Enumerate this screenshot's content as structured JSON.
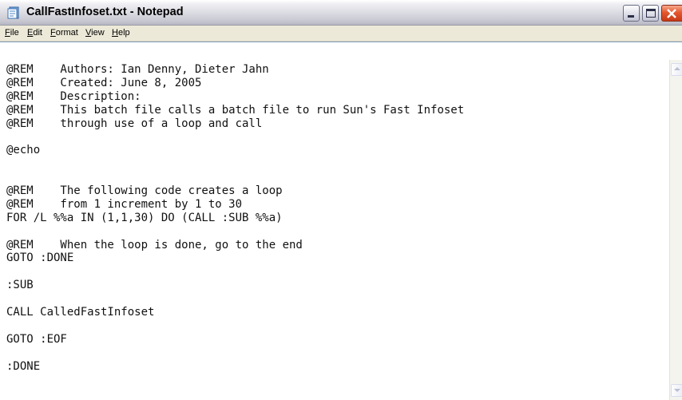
{
  "window": {
    "title": "CallFastInfoset.txt - Notepad",
    "app_icon": "notepad-icon"
  },
  "menu": [
    {
      "label": "File"
    },
    {
      "label": "Edit"
    },
    {
      "label": "Format"
    },
    {
      "label": "View"
    },
    {
      "label": "Help"
    }
  ],
  "editor": {
    "lines": [
      "@REM    Authors: Ian Denny, Dieter Jahn",
      "@REM    Created: June 8, 2005",
      "@REM    Description:",
      "@REM    This batch file calls a batch file to run Sun's Fast Infoset",
      "@REM    through use of a loop and call",
      "",
      "@echo",
      "",
      "",
      "@REM    The following code creates a loop",
      "@REM    from 1 increment by 1 to 30",
      "FOR /L %%a IN (1,1,30) DO (CALL :SUB %%a)",
      "",
      "@REM    When the loop is done, go to the end",
      "GOTO :DONE",
      "",
      ":SUB",
      "",
      "CALL CalledFastInfoset",
      "",
      "GOTO :EOF",
      "",
      ":DONE"
    ]
  }
}
